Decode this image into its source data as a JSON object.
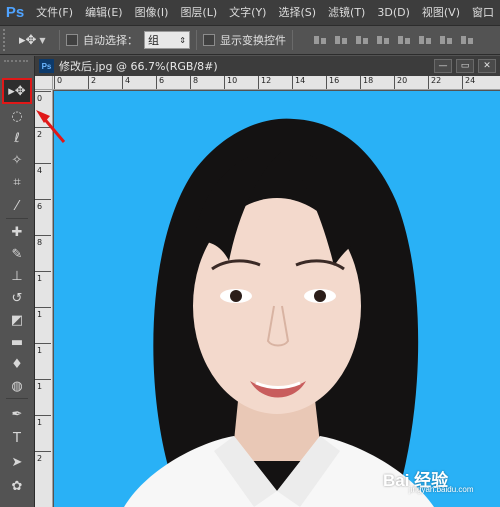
{
  "app": {
    "logo": "Ps"
  },
  "menu": [
    "文件(F)",
    "编辑(E)",
    "图像(I)",
    "图层(L)",
    "文字(Y)",
    "选择(S)",
    "滤镜(T)",
    "3D(D)",
    "视图(V)",
    "窗口"
  ],
  "options": {
    "auto_select_label": "自动选择：",
    "auto_select_value": "组",
    "show_transform_label": "显示变换控件"
  },
  "document": {
    "tab_icon": "Ps",
    "title": "修改后.jpg @ 66.7%(RGB/8#)",
    "win_minimize": "—",
    "win_restore": "▭",
    "win_close": "✕"
  },
  "ruler_h": [
    "0",
    "2",
    "4",
    "6",
    "8",
    "10",
    "12",
    "14",
    "16",
    "18",
    "20",
    "22",
    "24"
  ],
  "ruler_v": [
    "0",
    "2",
    "4",
    "6",
    "8",
    "1",
    "1",
    "1",
    "1",
    "1",
    "2"
  ],
  "tools": [
    {
      "name": "move-tool",
      "glyph": "▸✥"
    },
    {
      "name": "marquee-tool",
      "glyph": "◌"
    },
    {
      "name": "lasso-tool",
      "glyph": "ℓ"
    },
    {
      "name": "quick-select-tool",
      "glyph": "✧"
    },
    {
      "name": "crop-tool",
      "glyph": "⌗"
    },
    {
      "name": "eyedropper-tool",
      "glyph": "⁄"
    },
    {
      "name": "healing-brush-tool",
      "glyph": "✚"
    },
    {
      "name": "brush-tool",
      "glyph": "✎"
    },
    {
      "name": "clone-stamp-tool",
      "glyph": "⊥"
    },
    {
      "name": "history-brush-tool",
      "glyph": "↺"
    },
    {
      "name": "eraser-tool",
      "glyph": "◩"
    },
    {
      "name": "gradient-tool",
      "glyph": "▬"
    },
    {
      "name": "blur-tool",
      "glyph": "♦"
    },
    {
      "name": "dodge-tool",
      "glyph": "◍"
    },
    {
      "name": "pen-tool",
      "glyph": "✒"
    },
    {
      "name": "type-tool",
      "glyph": "T"
    },
    {
      "name": "path-select-tool",
      "glyph": "➤"
    },
    {
      "name": "shape-tool",
      "glyph": "✿"
    }
  ],
  "watermark": {
    "text": "Bai 经验",
    "sub": "jingyan.baidu.com"
  },
  "colors": {
    "canvas_bg": "#29b1f6",
    "highlight": "#e01818",
    "ui_dark": "#3d3d3d",
    "ui_mid": "#535353"
  }
}
